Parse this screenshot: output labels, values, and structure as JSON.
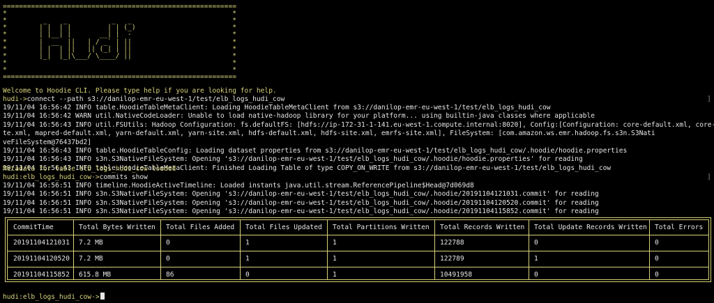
{
  "banner": [
    "==========================================================",
    "*                                                        *",
    "*         _    _           _   _                         *",
    "*        | |  | |         | | (_)                        *",
    "*        | |__| |       __| |  -                         *",
    "*        |  __  ||   | / _` | ||                         *",
    "*        | |  | ||   || (_| | ||                         *",
    "*        |_|  |_|\\___/ \\____/ ||                         *",
    "*                                                        *",
    "*                                                        *",
    "=========================================================="
  ],
  "welcome": "Welcome to Hoodie CLI. Please type help if you are looking for help.",
  "prompt1": {
    "prefix": "hudi->",
    "command": "connect --path s3://danilop-emr-eu-west-1/test/elb_logs_hudi_cow"
  },
  "log1": [
    "19/11/04 16:56:42 INFO table.HoodieTableMetaClient: Loading HoodieTableMetaClient from s3://danilop-emr-eu-west-1/test/elb_logs_hudi_cow",
    "19/11/04 16:56:42 WARN util.NativeCodeLoader: Unable to load native-hadoop library for your platform... using builtin-java classes where applicable",
    "19/11/04 16:56:43 INFO util.FSUtils: Hadoop Configuration: fs.defaultFS: [hdfs://ip-172-31-1-141.eu-west-1.compute.internal:8020], Config:[Configuration: core-default.xml, core-si",
    "te.xml, mapred-default.xml, yarn-default.xml, yarn-site.xml, hdfs-default.xml, hdfs-site.xml, emrfs-site.xml], FileSystem: [com.amazon.ws.emr.hadoop.fs.s3n.S3Nati",
    "veFileSystem@76437bd2]",
    "19/11/04 16:56:43 INFO table.HoodieTableConfig: Loading dataset properties from s3://danilop-emr-eu-west-1/test/elb_logs_hudi_cow/.hoodie/hoodie.properties",
    "19/11/04 16:56:43 INFO s3n.S3NativeFileSystem: Opening 's3://danilop-emr-eu-west-1/test/elb_logs_hudi_cow/.hoodie/hoodie.properties' for reading",
    "19/11/04 16:56:43 INFO table.HoodieTableMetaClient: Finished Loading Table of type COPY_ON_WRITE from s3://danilop-emr-eu-west-1/test/elb_logs_hudi_cow"
  ],
  "metadata_loaded": "Metadata for table elb_logs_hudi_cow loaded",
  "prompt2": {
    "prefix": "hudi:elb_logs_hudi_cow->",
    "command": "commits show"
  },
  "log2": [
    "19/11/04 16:56:51 INFO timeline.HoodieActiveTimeline: Loaded instants java.util.stream.ReferencePipeline$Head@7d069d8",
    "19/11/04 16:56:51 INFO s3n.S3NativeFileSystem: Opening 's3://danilop-emr-eu-west-1/test/elb_logs_hudi_cow/.hoodie/20191104121031.commit' for reading",
    "19/11/04 16:56:51 INFO s3n.S3NativeFileSystem: Opening 's3://danilop-emr-eu-west-1/test/elb_logs_hudi_cow/.hoodie/20191104120520.commit' for reading",
    "19/11/04 16:56:51 INFO s3n.S3NativeFileSystem: Opening 's3://danilop-emr-eu-west-1/test/elb_logs_hudi_cow/.hoodie/20191104115852.commit' for reading"
  ],
  "table": {
    "headers": [
      "CommitTime",
      "Total Bytes Written",
      "Total Files Added",
      "Total Files Updated",
      "Total Partitions Written",
      "Total Records Written",
      "Total Update Records Written",
      "Total Errors"
    ],
    "rows": [
      [
        "20191104121031",
        "7.2 MB",
        "0",
        "1",
        "1",
        "122788",
        "0",
        "0"
      ],
      [
        "20191104120520",
        "7.2 MB",
        "0",
        "1",
        "1",
        "122789",
        "1",
        "0"
      ],
      [
        "20191104115852",
        "615.8 MB",
        "86",
        "0",
        "1",
        "10491958",
        "0",
        "0"
      ]
    ]
  },
  "prompt3": {
    "prefix": "hudi:elb_logs_hudi_cow->",
    "command": ""
  }
}
